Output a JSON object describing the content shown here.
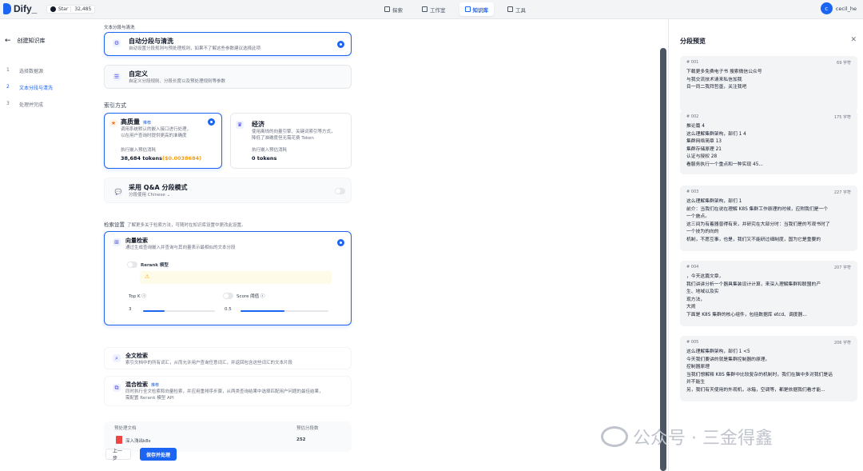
{
  "app": {
    "logo_text": "Dify_",
    "github": {
      "label": "Star",
      "count": "32,485"
    },
    "nav": [
      {
        "label": "探索",
        "icon": "compass-icon",
        "active": false
      },
      {
        "label": "工作室",
        "icon": "studio-icon",
        "active": false
      },
      {
        "label": "知识库",
        "icon": "book-icon",
        "active": true
      },
      {
        "label": "工具",
        "icon": "tool-icon",
        "active": false
      }
    ],
    "user": {
      "initial": "c",
      "name": "cecil_he"
    }
  },
  "steps": {
    "back_label": "创建知识库",
    "items": [
      {
        "num": "1",
        "label": "选择数据源"
      },
      {
        "num": "2",
        "label": "文本分段与清洗"
      },
      {
        "num": "3",
        "label": "处理并完成"
      }
    ]
  },
  "form": {
    "section_title": "文本分段与清洗",
    "segmentation": {
      "auto": {
        "title": "自动分段与清洗",
        "desc": "自动设置分段规则与预处理规则，如果不了解这些参数建议选择此项"
      },
      "custom": {
        "title": "自定义",
        "desc": "自定义分段规则、分段长度以及预处理规则等参数"
      }
    },
    "index_label": "索引方式",
    "index": {
      "high": {
        "title": "高质量",
        "tag": "推荐",
        "desc1": "调用系统默认的嵌入接口进行处理，",
        "desc2": "以在用户查询时提供更高的准确度",
        "est_label": "执行嵌入预估消耗",
        "tokens": "38,684 tokens",
        "price": "($0.0038684)"
      },
      "eco": {
        "title": "经济",
        "desc1": "使用离线的向量引擎、关键词索引等方式，",
        "desc2": "降低了准确度但无需花费 Token",
        "est_label": "执行嵌入预估消耗",
        "tokens": "0 tokens"
      }
    },
    "qa": {
      "title": "采用 Q&A 分段模式",
      "lang_label": "分段使用",
      "lang_value": "Chinese"
    },
    "retrieval_label": "检索设置",
    "retrieval_hint": "了解更多关于检索方法，可随时在知识库设置中更改此设置。",
    "vector": {
      "title": "向量检索",
      "desc": "通过生成查询嵌入并查询与其向量表示最相似的文本分段",
      "rerank_label": "Rerank 模型",
      "topk_label": "Top K",
      "topk_value": "3",
      "score_label": "Score 阈值",
      "score_value": "0.5",
      "topk_fill": 0.3,
      "score_fill": 0.5
    },
    "fulltext": {
      "title": "全文检索",
      "desc": "索引文档中的所有词汇，从而允许用户查询任意词汇，并返回包含这些词汇的文本片段"
    },
    "hybrid": {
      "title": "混合检索",
      "tag": "推荐",
      "desc1": "同时执行全文检索和向量检索，并应用重排序步骤，从两类查询结果中选择匹配用户问题的最佳结果，",
      "desc2": "需配置 Rerank 模型 API"
    },
    "summary": {
      "doc_label": "预处理文档",
      "doc_name": "深入浅出k8s",
      "count_label": "预估分段数",
      "count_value": "252"
    },
    "buttons": {
      "prev": "上一步",
      "save": "保存并处理"
    }
  },
  "preview": {
    "title": "分段预览",
    "chunks": [
      {
        "id": "# 001",
        "chars": "69 字符",
        "lines": [
          "下载更多免费电子书 搜索微信公众号",
          "与我交流技术请来私信加我",
          "目一同二我拜哲墨，关注我吧"
        ]
      },
      {
        "id": "# 002",
        "chars": "175 字符",
        "lines": [
          "推论篇 4",
          "这么理解集群架构，部们 1 4",
          "集群网络简章 13",
          "集群存储原理 21",
          "认证与授权 28",
          "看服务执行一个重点和一种实现 45..."
        ]
      },
      {
        "id": "# 003",
        "chars": "227 字符",
        "lines": [
          "这么理解集群架构，部们 1",
          "前介：当我们在说在理解 K8S 集群工作原理的时候，应附我们是一个",
          "一个施点。",
          "这三间为有着器普得有来，并研究在大部分时：当我们是的写观书时了",
          "一个技为的向的",
          "机制，不愿互事，也是，我们又不能研过细制度，国为它是重要的"
        ]
      },
      {
        "id": "# 004",
        "chars": "207 字符",
        "lines": [
          "，今天这篇文章，",
          "我们讲讲分析一个器具集装设计计算，来深入理解集群和联盟的产",
          "生、地域以及实",
          "现方法，",
          "大闹",
          "下面是 K8S 集群的核心组件，包括数据库 etcd、调度器..."
        ]
      },
      {
        "id": "# 005",
        "chars": "206 字符",
        "lines": [
          "这么理解集群架构，部们 1 <5",
          "今天我们要讲的就是集群控制器的原理。",
          "控制器原理",
          "当我们想解释 K8S 集群中比较复杂的机制时，我们在脑中多对我们是话",
          "并不能生",
          "另，我们有天使用的外观机，冰箱，空调等，都是依据我们看才能..."
        ]
      }
    ]
  },
  "watermark": "公众号 · 三金得鑫"
}
